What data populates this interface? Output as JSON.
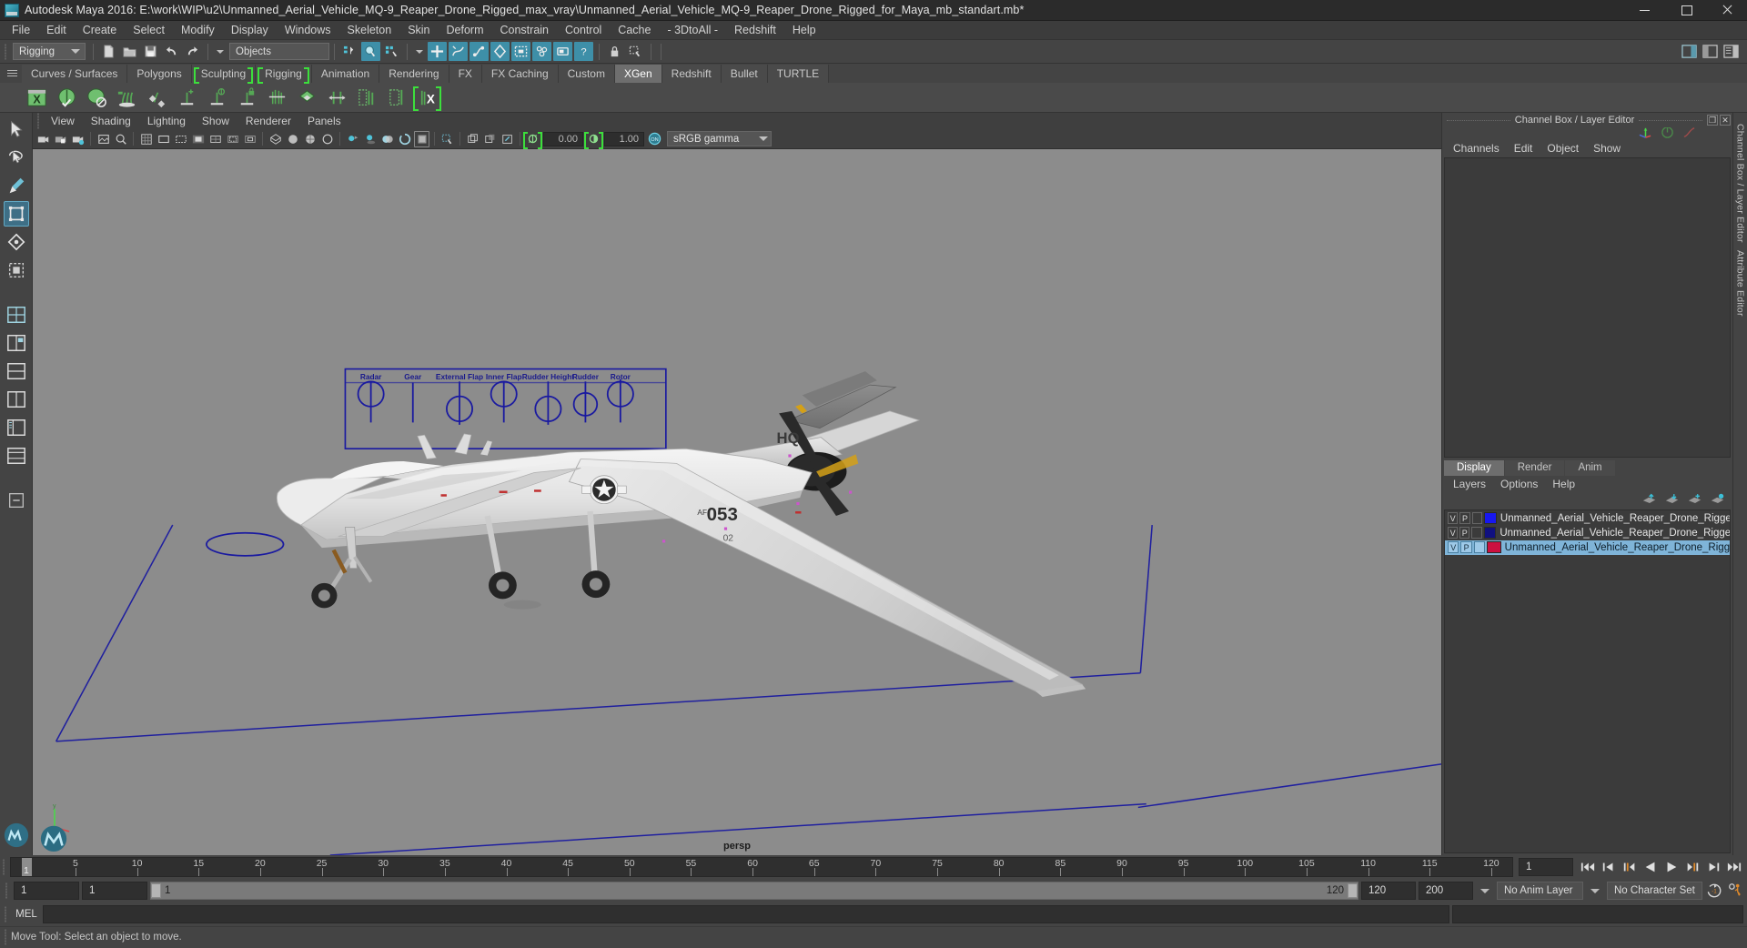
{
  "window": {
    "title": "Autodesk Maya 2016: E:\\work\\WIP\\u2\\Unmanned_Aerial_Vehicle_MQ-9_Reaper_Drone_Rigged_max_vray\\Unmanned_Aerial_Vehicle_MQ-9_Reaper_Drone_Rigged_for_Maya_mb_standart.mb*",
    "minimize": "minimize",
    "maximize": "maximize",
    "close": "close"
  },
  "menubar": {
    "items": [
      {
        "label": "File"
      },
      {
        "label": "Edit"
      },
      {
        "label": "Create"
      },
      {
        "label": "Select"
      },
      {
        "label": "Modify"
      },
      {
        "label": "Display"
      },
      {
        "label": "Windows"
      },
      {
        "label": "Skeleton"
      },
      {
        "label": "Skin"
      },
      {
        "label": "Deform"
      },
      {
        "label": "Constrain"
      },
      {
        "label": "Control"
      },
      {
        "label": "Cache"
      },
      {
        "label": "- 3DtoAll -"
      },
      {
        "label": "Redshift"
      },
      {
        "label": "Help"
      }
    ]
  },
  "statusline": {
    "menuset": "Rigging",
    "object_field": "Objects",
    "icons": [
      "new-scene-icon",
      "open-scene-icon",
      "save-scene-icon",
      "undo-icon",
      "redo-icon",
      "select-by-hierarchy-icon",
      "select-by-object-icon",
      "select-by-component-icon",
      "snap-to-grid-icon",
      "snap-to-curve-icon",
      "snap-to-point-icon",
      "snap-to-projected-center-icon",
      "snap-to-view-plane-icon",
      "make-live-icon",
      "render-view-icon",
      "render-settings-icon",
      "lock-icon",
      "selection-mask-icon"
    ],
    "right_icons": [
      "sidebar-attribute-editor-icon",
      "sidebar-tool-settings-icon",
      "sidebar-channel-box-icon"
    ]
  },
  "shelf": {
    "tabs": [
      {
        "label": "Curves / Surfaces",
        "active": false,
        "bracket": false
      },
      {
        "label": "Polygons",
        "active": false,
        "bracket": false
      },
      {
        "label": "Sculpting",
        "active": false,
        "bracket": true
      },
      {
        "label": "Rigging",
        "active": false,
        "bracket": true
      },
      {
        "label": "Animation",
        "active": false,
        "bracket": false
      },
      {
        "label": "Rendering",
        "active": false,
        "bracket": false
      },
      {
        "label": "FX",
        "active": false,
        "bracket": false
      },
      {
        "label": "FX Caching",
        "active": false,
        "bracket": false
      },
      {
        "label": "Custom",
        "active": false,
        "bracket": false
      },
      {
        "label": "XGen",
        "active": true,
        "bracket": false
      },
      {
        "label": "Redshift",
        "active": false,
        "bracket": false
      },
      {
        "label": "Bullet",
        "active": false,
        "bracket": false
      },
      {
        "label": "TURTLE",
        "active": false,
        "bracket": false
      }
    ],
    "items": [
      "xgen-editor-icon",
      "xgen-preview-icon",
      "xgen-description-icon",
      "xgen-add-clumping-icon",
      "xgen-add-noise-icon",
      "xgen-groom-add-icon",
      "xgen-groom-density-icon",
      "xgen-groom-lock-icon",
      "xgen-groom-comb-icon",
      "xgen-convert-polygons-icon",
      "xgen-spline-width-icon",
      "xgen-guide-tool-icon",
      "xgen-sculpt-guide-icon",
      "xgen-export-icon"
    ]
  },
  "toolbox": {
    "tools": [
      {
        "name": "select-tool",
        "selected": false
      },
      {
        "name": "lasso-select-tool",
        "selected": false
      },
      {
        "name": "paint-select-tool",
        "selected": false
      },
      {
        "name": "move-tool",
        "selected": true
      },
      {
        "name": "rotate-tool",
        "selected": false
      },
      {
        "name": "scale-tool",
        "selected": false
      },
      {
        "name": "last-tool-used",
        "selected": false
      },
      {
        "name": "layout-single-perspective",
        "selected": false
      },
      {
        "name": "layout-four-view",
        "selected": false
      },
      {
        "name": "layout-two-pane-side",
        "selected": false
      },
      {
        "name": "layout-two-pane-stacked",
        "selected": false
      },
      {
        "name": "layout-outliner-persp",
        "selected": false
      },
      {
        "name": "layout-hypergraph-persp",
        "selected": false
      },
      {
        "name": "layout-more",
        "selected": false
      }
    ]
  },
  "viewport": {
    "menus": [
      {
        "label": "View"
      },
      {
        "label": "Shading"
      },
      {
        "label": "Lighting"
      },
      {
        "label": "Show"
      },
      {
        "label": "Renderer"
      },
      {
        "label": "Panels"
      }
    ],
    "camera_label": "persp",
    "exposure_value": "0.00",
    "gamma_value": "1.00",
    "color_management": "sRGB gamma",
    "toolbar_icons": [
      "select-camera-icon",
      "lock-camera-icon",
      "camera-attributes-icon",
      "image-plane-icon",
      "two-d-pan-zoom-icon",
      "grid-toggle-icon",
      "film-gate-icon",
      "resolution-gate-icon",
      "gate-mask-icon",
      "field-chart-icon",
      "safe-action-icon",
      "safe-title-icon",
      "wireframe-icon",
      "smooth-shade-all-icon",
      "shaded-wireframe-icon",
      "use-all-lights-icon",
      "shadows-icon",
      "screen-space-ao-icon",
      "motion-blur-icon",
      "multisample-icon",
      "depth-of-field-icon",
      "isolate-select-icon",
      "xray-icon",
      "xray-joints-icon",
      "xray-active-components-icon",
      "exposure-toggle-icon",
      "gamma-toggle-icon"
    ],
    "rig_controls": [
      {
        "label": "Radar"
      },
      {
        "label": "Gear"
      },
      {
        "label": "External Flap"
      },
      {
        "label": "Inner Flap"
      },
      {
        "label": "Rudder Height"
      },
      {
        "label": "Rudder"
      },
      {
        "label": "Rotor"
      }
    ],
    "aircraft_markings": {
      "tail_code": "HQ",
      "serial": "053",
      "serial_prefix": "AF",
      "roundel": "us-air-force-roundel"
    }
  },
  "channel_box": {
    "panel_title": "Channel Box / Layer Editor",
    "menus": [
      {
        "label": "Channels"
      },
      {
        "label": "Edit"
      },
      {
        "label": "Object"
      },
      {
        "label": "Show"
      }
    ],
    "header_icons": [
      "manipulator-icon",
      "non-keyable-icon",
      "anim-curve-icon"
    ],
    "panel_buttons": [
      "restore-panel-icon",
      "close-panel-icon"
    ]
  },
  "layer_editor": {
    "tabs": [
      {
        "label": "Display",
        "active": true
      },
      {
        "label": "Render",
        "active": false
      },
      {
        "label": "Anim",
        "active": false
      }
    ],
    "menus": [
      {
        "label": "Layers"
      },
      {
        "label": "Options"
      },
      {
        "label": "Help"
      }
    ],
    "buttons": [
      "move-layer-up-icon",
      "move-layer-down-icon",
      "new-layer-icon",
      "new-layer-from-selected-icon"
    ],
    "layers": [
      {
        "visibility": "V",
        "playback": "P",
        "state": "",
        "color": "#1717f0",
        "name": "Unmanned_Aerial_Vehicle_Reaper_Drone_Rigged_Helpe",
        "selected": false
      },
      {
        "visibility": "V",
        "playback": "P",
        "state": "",
        "color": "#101080",
        "name": "Unmanned_Aerial_Vehicle_Reaper_Drone_Rigged_Sliders",
        "selected": false
      },
      {
        "visibility": "V",
        "playback": "P",
        "state": "",
        "color": "#cc1040",
        "name": "Unmanned_Aerial_Vehicle_Reaper_Drone_Rigged",
        "selected": true
      }
    ]
  },
  "sidebars": {
    "right_tabs": [
      {
        "label": "Channel Box / Layer Editor"
      },
      {
        "label": "Attribute Editor"
      }
    ]
  },
  "timeline": {
    "ticks": [
      5,
      10,
      15,
      20,
      25,
      30,
      35,
      40,
      45,
      50,
      55,
      60,
      65,
      70,
      75,
      80,
      85,
      90,
      95,
      100,
      105,
      110,
      115,
      120
    ],
    "current_frame_marker": "1",
    "current_frame_field": "1",
    "playback_buttons": [
      "go-to-start-icon",
      "step-back-keyframe-icon",
      "step-back-frame-icon",
      "play-backwards-icon",
      "play-forwards-icon",
      "step-forward-frame-icon",
      "step-forward-keyframe-icon",
      "go-to-end-icon"
    ]
  },
  "range_slider": {
    "anim_start": "1",
    "range_start": "1",
    "bar_start": "1",
    "bar_end": "120",
    "range_end": "120",
    "anim_end": "200",
    "anim_layer": "No Anim Layer",
    "character_set": "No Character Set",
    "auto_key": "auto-keyframe-icon",
    "anim_prefs": "animation-preferences-icon"
  },
  "command_line": {
    "language_label": "MEL",
    "input_value": "",
    "output_value": ""
  },
  "help_line": {
    "text": "Move Tool: Select an object to move."
  }
}
